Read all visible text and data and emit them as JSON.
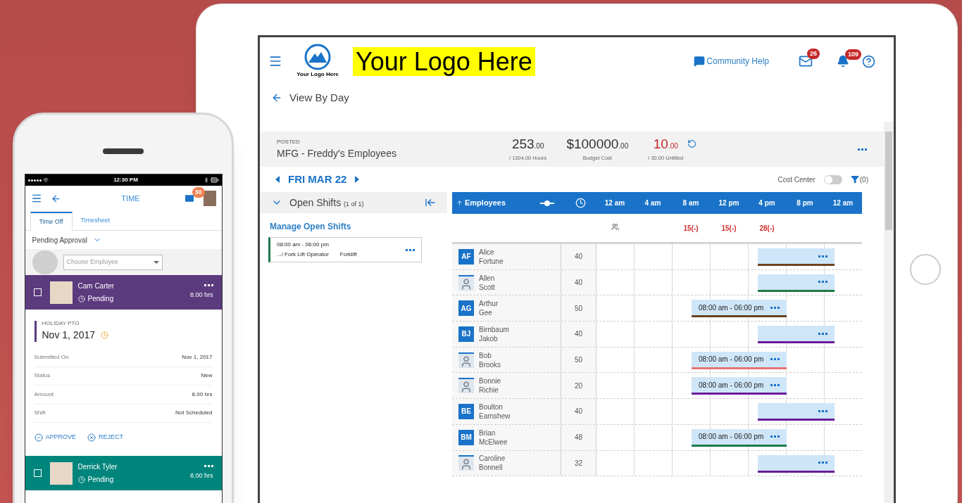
{
  "phone": {
    "status_bar": {
      "time": "12:30 PM"
    },
    "header": {
      "title": "TIME",
      "mail_badge": "30"
    },
    "tabs": [
      {
        "label": "Time Off",
        "selected": true
      },
      {
        "label": "Timesheet",
        "selected": false
      }
    ],
    "filter": {
      "label": "Pending Approval"
    },
    "employee_select": {
      "placeholder": "Choose Employee"
    },
    "requests": [
      {
        "name": "Cam Carter",
        "status": "Pending",
        "hours": "8.00 hrs",
        "checked": false,
        "color": "#5b3a7e",
        "detail": {
          "type": "HOLIDAY PTO",
          "date": "Nov 1, 2017",
          "rows": [
            {
              "label": "Submitted On",
              "value": "Nov 1, 2017"
            },
            {
              "label": "Status",
              "value": "New"
            },
            {
              "label": "Amount",
              "value": "8.00 hrs"
            },
            {
              "label": "Shift",
              "value": "Not Scheduled"
            }
          ],
          "actions": [
            {
              "kind": "approve",
              "label": "APPROVE"
            },
            {
              "kind": "reject",
              "label": "REJECT"
            }
          ]
        }
      },
      {
        "name": "Derrick Tyler",
        "status": "Pending",
        "hours": "8.00 hrs",
        "checked": false,
        "color": "#00857c"
      }
    ]
  },
  "tablet": {
    "header": {
      "logo_caption": "Your Logo Here",
      "logo_banner": "Your Logo Here",
      "help": "Community Help",
      "mail_badge": "26",
      "bell_badge": "109"
    },
    "back": {
      "label": "View By Day"
    },
    "summary": {
      "status": "POSTED",
      "group": "MFG - Freddy's Employees",
      "stats": [
        {
          "kind": "normal",
          "value": "253",
          "decimals": ".00",
          "caption": "/ 1304.00 Hours"
        },
        {
          "kind": "normal",
          "value": "$100000",
          "decimals": ".00",
          "caption": "Budget Cost"
        },
        {
          "kind": "alert",
          "value": "10",
          "decimals": ".00",
          "caption": "/ 30.00 Unfilled"
        }
      ]
    },
    "date": {
      "label": "FRI MAR 22"
    },
    "cost_center": {
      "label": "Cost Center",
      "on": false
    },
    "filter_count": "(0)",
    "open_shifts": {
      "title": "Open Shifts",
      "count": "(1 of 1)",
      "expanded": true,
      "link": "Manage Open Shifts",
      "shifts": [
        {
          "time": "08:00 am - 06:00 pm",
          "role": ".../ Fork Lift Operator",
          "station": "Forklift"
        }
      ]
    },
    "grid": {
      "column": "Employees",
      "hours": [
        "12 am",
        "4 am",
        "8 am",
        "12 pm",
        "4 pm",
        "8 pm",
        "12 am"
      ],
      "coverage": [
        {
          "kind": "icon"
        },
        {
          "kind": "blank"
        },
        {
          "kind": "count",
          "text": "15(-)"
        },
        {
          "kind": "count",
          "text": "15(-)"
        },
        {
          "kind": "count",
          "text": "28(-)"
        },
        {
          "kind": "blank"
        },
        {
          "kind": "blank"
        }
      ],
      "rows": [
        {
          "first": "Alice",
          "last": "Fortune",
          "kind": "initials",
          "initials": "AF",
          "hours": "40",
          "shift": {
            "kind": "evening",
            "color": "#6b4423"
          }
        },
        {
          "first": "Allen",
          "last": "Scott",
          "kind": "photo",
          "hours": "40",
          "shift": {
            "kind": "evening",
            "color": "#1e7a4a"
          }
        },
        {
          "first": "Arthur",
          "last": "Gee",
          "kind": "initials",
          "initials": "AG",
          "hours": "50",
          "shift": {
            "kind": "day",
            "time": "08:00 am - 06:00 pm",
            "color": "#6b4423"
          }
        },
        {
          "first": "Birnbaum",
          "last": "Jakob",
          "kind": "initials",
          "initials": "BJ",
          "hours": "40",
          "shift": {
            "kind": "evening",
            "color": "#6a1b9a"
          }
        },
        {
          "first": "Bob",
          "last": "Brooks",
          "kind": "photo",
          "hours": "50",
          "shift": {
            "kind": "day",
            "time": "08:00 am - 06:00 pm",
            "color": "#e57373"
          }
        },
        {
          "first": "Bonnie",
          "last": "Richie",
          "kind": "photo",
          "hours": "20",
          "shift": {
            "kind": "day",
            "time": "08:00 am - 06:00 pm",
            "color": "#6a1b9a"
          }
        },
        {
          "first": "Boulton",
          "last": "Earnshew",
          "kind": "initials",
          "initials": "BE",
          "hours": "40",
          "shift": {
            "kind": "evening",
            "color": "#6a1b9a"
          }
        },
        {
          "first": "Brian",
          "last": "McElwee",
          "kind": "initials",
          "initials": "BM",
          "hours": "48",
          "shift": {
            "kind": "day",
            "time": "08:00 am - 06:00 pm",
            "color": "#1e7a4a"
          }
        },
        {
          "first": "Caroline",
          "last": "Bonnell",
          "kind": "photo",
          "hours": "32",
          "shift": {
            "kind": "evening",
            "color": "#6a1b9a"
          }
        }
      ]
    }
  }
}
